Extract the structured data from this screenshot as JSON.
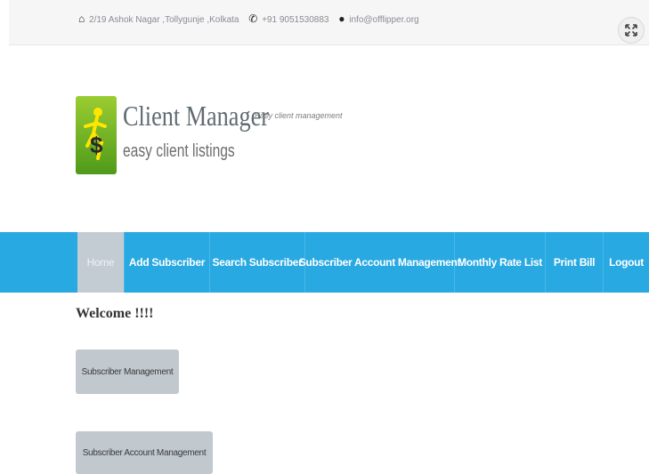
{
  "header": {
    "address": "2/19 Ashok Nagar ,Tollygunje ,Kolkata",
    "phone": "+91 9051530883",
    "email": "info@offlipper.org",
    "expand_icon": "expand-icon"
  },
  "brand": {
    "title": "Client Manager",
    "subtitle": "easy client listings",
    "tagline": "Easy client management",
    "logo_color": "#6fb22a"
  },
  "nav": {
    "items": [
      {
        "label": "Home"
      },
      {
        "label": "Add Subscriber"
      },
      {
        "label": "Search Subscriber"
      },
      {
        "label": "Subscriber Account Management"
      },
      {
        "label": "Monthly Rate List"
      },
      {
        "label": "Print Bill"
      },
      {
        "label": "Logout"
      }
    ],
    "active": "Home",
    "color": "#29a9e1"
  },
  "main": {
    "welcome": "Welcome !!!!",
    "buttons": [
      {
        "label": "Subscriber Management"
      },
      {
        "label": "Subscriber Account Management"
      }
    ]
  }
}
